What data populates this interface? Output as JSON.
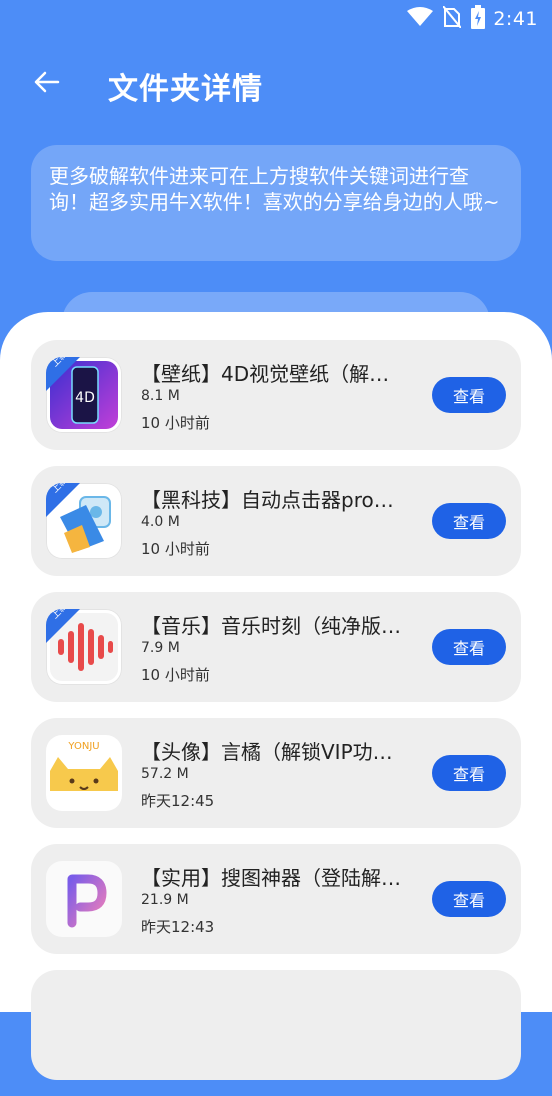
{
  "status_bar": {
    "time": "2:41",
    "icons": [
      "wifi-icon",
      "no-sim-icon",
      "battery-charging-icon"
    ]
  },
  "header": {
    "title": "文件夹详情",
    "back_icon": "arrow-left-icon"
  },
  "notice": {
    "text": "更多破解软件进来可在上方搜软件关键词进行查询！超多实用牛X软件！喜欢的分享给身边的人哦~"
  },
  "colors": {
    "primary": "#4d8df7",
    "button": "#1f62e6",
    "card": "#eeeeee"
  },
  "files": [
    {
      "title": "【壁纸】4D视觉壁纸（解…",
      "size": "8.1 M",
      "time": "10 小时前",
      "badge": "上新",
      "button": "查看",
      "icon": "4d-wallpaper-icon"
    },
    {
      "title": "【黑科技】自动点击器pro…",
      "size": "4.0 M",
      "time": "10 小时前",
      "badge": "上新",
      "button": "查看",
      "icon": "auto-clicker-icon"
    },
    {
      "title": "【音乐】音乐时刻（纯净版…",
      "size": "7.9 M",
      "time": "10 小时前",
      "badge": "上新",
      "button": "查看",
      "icon": "music-wave-icon"
    },
    {
      "title": "【头像】言橘（解锁VIP功…",
      "size": "57.2 M",
      "time": "昨天12:45",
      "badge": "",
      "button": "查看",
      "icon": "cat-avatar-icon"
    },
    {
      "title": "【实用】搜图神器（登陆解…",
      "size": "21.9 M",
      "time": "昨天12:43",
      "badge": "",
      "button": "查看",
      "icon": "p-logo-icon"
    }
  ]
}
